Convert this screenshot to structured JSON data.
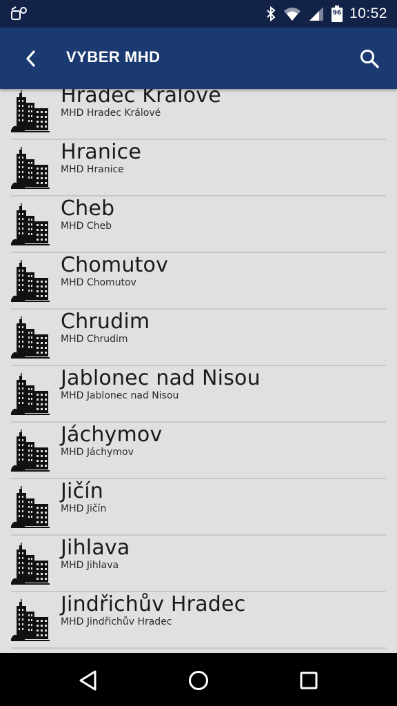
{
  "status_bar": {
    "time": "10:52",
    "battery_level": "96",
    "icons": [
      "lock-rotation-icon",
      "bluetooth-icon",
      "wifi-icon",
      "signal-icon",
      "battery-icon"
    ]
  },
  "app_bar": {
    "title": "VYBER MHD",
    "back_icon": "chevron-left-icon",
    "search_icon": "search-icon",
    "background": "#1b3a72"
  },
  "list": {
    "item_icon": "city-buildings-icon",
    "items": [
      {
        "name": "Hradec Králové",
        "subtitle": "MHD Hradec Králové"
      },
      {
        "name": "Hranice",
        "subtitle": "MHD Hranice"
      },
      {
        "name": "Cheb",
        "subtitle": "MHD Cheb"
      },
      {
        "name": "Chomutov",
        "subtitle": "MHD Chomutov"
      },
      {
        "name": "Chrudim",
        "subtitle": "MHD Chrudim"
      },
      {
        "name": "Jablonec nad Nisou",
        "subtitle": "MHD Jablonec nad Nisou"
      },
      {
        "name": "Jáchymov",
        "subtitle": "MHD Jáchymov"
      },
      {
        "name": "Jičín",
        "subtitle": "MHD Jičín"
      },
      {
        "name": "Jihlava",
        "subtitle": "MHD Jihlava"
      },
      {
        "name": "Jindřichův Hradec",
        "subtitle": "MHD Jindřichův Hradec"
      }
    ]
  },
  "nav_bar": {
    "buttons": [
      "back-triangle-icon",
      "home-circle-icon",
      "recents-square-icon"
    ]
  }
}
